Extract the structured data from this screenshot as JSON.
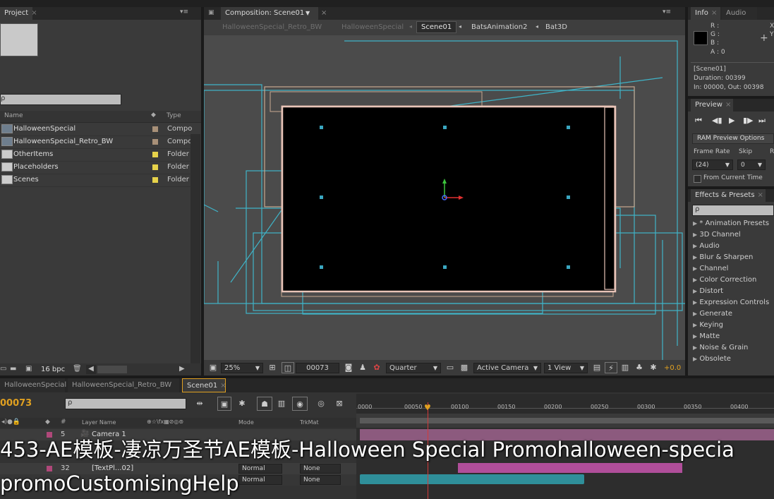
{
  "project": {
    "tab": "Project",
    "columns": {
      "name": "Name",
      "type": "Type"
    },
    "items": [
      {
        "name": "HalloweenSpecial",
        "type": "Compo",
        "color": "#a89078",
        "icon": "composition-icon"
      },
      {
        "name": "HalloweenSpecial_Retro_BW",
        "type": "Compo",
        "color": "#a89078",
        "icon": "composition-icon"
      },
      {
        "name": "OtherItems",
        "type": "Folder",
        "color": "#e6d24a",
        "icon": "folder-icon"
      },
      {
        "name": "Placeholders",
        "type": "Folder",
        "color": "#e6d24a",
        "icon": "folder-icon"
      },
      {
        "name": "Scenes",
        "type": "Folder",
        "color": "#e6d24a",
        "icon": "folder-icon"
      }
    ],
    "bpc": "16 bpc"
  },
  "composition": {
    "tab": "Composition: Scene01",
    "breadcrumbs": [
      "HalloweenSpecial_Retro_BW",
      "HalloweenSpecial",
      "Scene01",
      "BatsAnimation2",
      "Bat3D"
    ],
    "active_crumb": "Scene01",
    "zoom": "25%",
    "timecode": "00073",
    "resolution": "Quarter",
    "camera": "Active Camera",
    "views": "1 View",
    "exposure": "+0.0"
  },
  "info": {
    "tabs": [
      "Info",
      "Audio"
    ],
    "rgba": [
      "R :",
      "G :",
      "B :",
      "A : 0"
    ],
    "xy": [
      "X",
      "Y"
    ],
    "details": [
      "[Scene01]",
      "Duration: 00399",
      "In: 00000, Out: 00398"
    ]
  },
  "preview": {
    "tab": "Preview",
    "ram_button": "RAM Preview Options",
    "frame_rate_label": "Frame Rate",
    "skip_label": "Skip",
    "r_label": "R",
    "frame_rate": "(24)",
    "skip": "0",
    "from_current": "From Current Time"
  },
  "effects": {
    "tab": "Effects & Presets",
    "items": [
      "* Animation Presets",
      "3D Channel",
      "Audio",
      "Blur & Sharpen",
      "Channel",
      "Color Correction",
      "Distort",
      "Expression Controls",
      "Generate",
      "Keying",
      "Matte",
      "Noise & Grain",
      "Obsolete"
    ]
  },
  "timeline": {
    "tabs": [
      "HalloweenSpecial",
      "HalloweenSpecial_Retro_BW",
      "Scene01"
    ],
    "active_tab": "Scene01",
    "timecode": "00073",
    "ruler": [
      "0000",
      "00050",
      "00100",
      "00150",
      "00200",
      "00250",
      "00300",
      "00350",
      "00400"
    ],
    "columns": {
      "layer_name": "Layer Name",
      "mode": "Mode",
      "trkmat": "TrkMat",
      "num": "#"
    },
    "layers": [
      {
        "num": "5",
        "name": "Camera 1",
        "mode": "",
        "trkmat": ""
      },
      {
        "num": "32",
        "name": "[TextPl...02]",
        "mode": "Normal",
        "trkmat": "None"
      },
      {
        "num": "",
        "name": "",
        "mode": "Normal",
        "trkmat": "None"
      }
    ]
  },
  "caption": {
    "line1": "453-AE模板-凄凉万圣节AE模板-Halloween Special Promohalloween-specia",
    "line2": "promoCustomisingHelp"
  },
  "colors": {
    "wire": "#3fb4c8",
    "frame_outline": "#e8c4b8",
    "layer_bar_pink": "#b04e9a",
    "layer_bar_teal": "#2f8f9a",
    "playhead": "#d33a3a",
    "timecode_orange": "#e0a020"
  }
}
